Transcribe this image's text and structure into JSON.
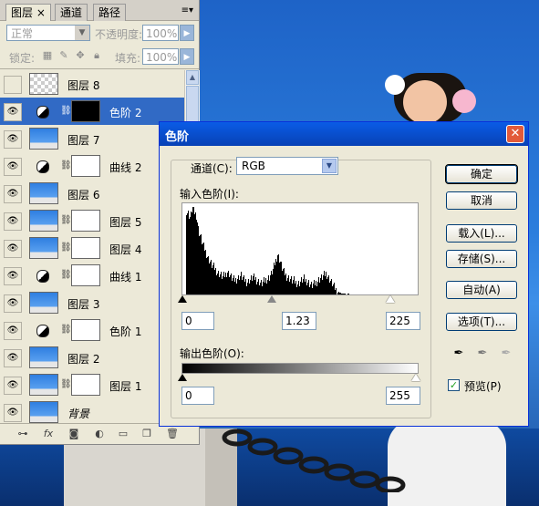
{
  "layers_panel": {
    "tabs": [
      {
        "label": "图层 ×"
      },
      {
        "label": "通道"
      },
      {
        "label": "路径"
      }
    ],
    "blend_mode": "正常",
    "opacity_label": "不透明度:",
    "opacity_value": "100%",
    "lock_label": "锁定:",
    "fill_label": "填充:",
    "fill_value": "100%",
    "layers": [
      {
        "name": "图层 8",
        "visible": false,
        "kind": "pixel",
        "thumb": "checker",
        "selected": false
      },
      {
        "name": "色阶 2",
        "visible": true,
        "kind": "adjustment",
        "thumb": "black",
        "selected": true
      },
      {
        "name": "图层 7",
        "visible": true,
        "kind": "pixel",
        "thumb": "photo",
        "selected": false
      },
      {
        "name": "曲线 2",
        "visible": true,
        "kind": "adjustment",
        "thumb": "white",
        "selected": false
      },
      {
        "name": "图层 6",
        "visible": true,
        "kind": "pixel",
        "thumb": "photo",
        "selected": false
      },
      {
        "name": "图层 5",
        "visible": true,
        "kind": "masked",
        "thumb": "photo",
        "selected": false
      },
      {
        "name": "图层 4",
        "visible": true,
        "kind": "masked",
        "thumb": "photo",
        "selected": false
      },
      {
        "name": "曲线 1",
        "visible": true,
        "kind": "adjustment",
        "thumb": "white",
        "selected": false
      },
      {
        "name": "图层 3",
        "visible": true,
        "kind": "pixel",
        "thumb": "photo",
        "selected": false
      },
      {
        "name": "色阶 1",
        "visible": true,
        "kind": "adjustment",
        "thumb": "white",
        "selected": false
      },
      {
        "name": "图层 2",
        "visible": true,
        "kind": "pixel",
        "thumb": "photo",
        "selected": false
      },
      {
        "name": "图层 1",
        "visible": true,
        "kind": "masked",
        "thumb": "photo",
        "selected": false
      },
      {
        "name": "背景",
        "visible": true,
        "kind": "background",
        "thumb": "photo",
        "selected": false
      }
    ],
    "bottom_icons": [
      "link-icon",
      "fx-icon",
      "mask-icon",
      "adjustment-icon",
      "folder-icon",
      "new-layer-icon",
      "trash-icon"
    ]
  },
  "levels_dialog": {
    "title": "色阶",
    "channel_label": "通道(C):",
    "channel_value": "RGB",
    "input_levels_label": "输入色阶(I):",
    "input_black": "0",
    "input_gamma": "1.23",
    "input_white": "225",
    "output_levels_label": "输出色阶(O):",
    "output_black": "0",
    "output_white": "255",
    "buttons": {
      "ok": "确定",
      "cancel": "取消",
      "load": "载入(L)...",
      "save": "存储(S)...",
      "auto": "自动(A)",
      "options": "选项(T)..."
    },
    "preview_label": "预览(P)",
    "preview_checked": true,
    "histogram_profile": [
      96,
      92,
      88,
      100,
      94,
      90,
      72,
      66,
      58,
      52,
      46,
      40,
      36,
      32,
      30,
      26,
      24,
      22,
      20,
      22,
      26,
      24,
      20,
      18,
      16,
      18,
      20,
      22,
      18,
      16,
      14,
      16,
      18,
      20,
      18,
      16,
      14,
      12,
      14,
      16,
      18,
      20,
      24,
      30,
      38,
      46,
      40,
      32,
      26,
      22,
      20,
      18,
      16,
      16,
      14,
      12,
      14,
      16,
      18,
      16,
      14,
      12,
      10,
      12,
      14,
      16,
      18,
      20,
      22,
      24,
      20,
      16,
      12,
      8,
      5,
      3,
      2,
      1,
      1,
      0,
      1,
      0
    ]
  }
}
